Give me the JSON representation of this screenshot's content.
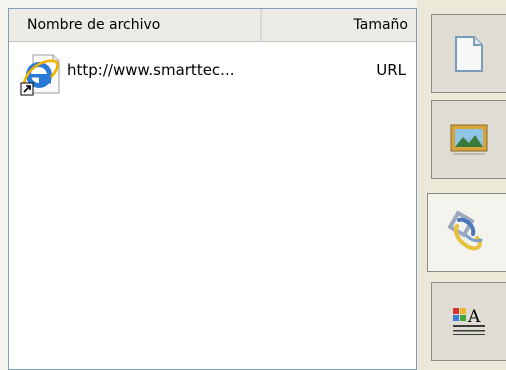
{
  "file_list": {
    "columns": {
      "name": "Nombre de archivo",
      "size": "Tamaño"
    },
    "rows": [
      {
        "name": "http://www.smarttec...",
        "size": "URL",
        "icon": "internet-explorer-shortcut-icon"
      }
    ]
  },
  "tabs": [
    {
      "name": "page-icon",
      "active": false
    },
    {
      "name": "picture-icon",
      "active": false
    },
    {
      "name": "attachment-link-icon",
      "active": true
    },
    {
      "name": "text-properties-icon",
      "active": false
    }
  ]
}
